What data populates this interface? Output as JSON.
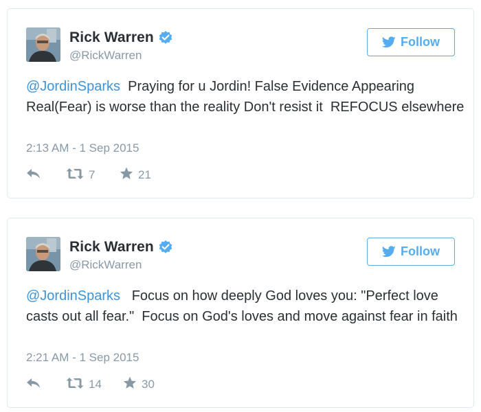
{
  "tweets": [
    {
      "display_name": "Rick Warren",
      "handle": "@RickWarren",
      "follow_label": "Follow",
      "mention": "@JordinSparks",
      "text": "  Praying for u Jordin! False Evidence Appearing Real(Fear) is worse than the reality Don't resist it  REFOCUS elsewhere",
      "timestamp": "2:13 AM - 1 Sep 2015",
      "retweets": "7",
      "favorites": "21"
    },
    {
      "display_name": "Rick Warren",
      "handle": "@RickWarren",
      "follow_label": "Follow",
      "mention": "@JordinSparks",
      "text": "   Focus on how deeply God loves you: \"Perfect love casts out all fear.\"  Focus on God's loves and move against fear in faith",
      "timestamp": "2:21 AM - 1 Sep 2015",
      "retweets": "14",
      "favorites": "30"
    }
  ],
  "colors": {
    "accent": "#55acee",
    "link": "#3b94d9",
    "muted": "#8899a6",
    "text": "#292f33",
    "border": "#e1e8ed"
  },
  "icons": {
    "verified": "verified-badge-icon",
    "follow": "twitter-bird-icon",
    "reply": "reply-arrow-icon",
    "retweet": "retweet-icon",
    "favorite": "star-icon"
  }
}
